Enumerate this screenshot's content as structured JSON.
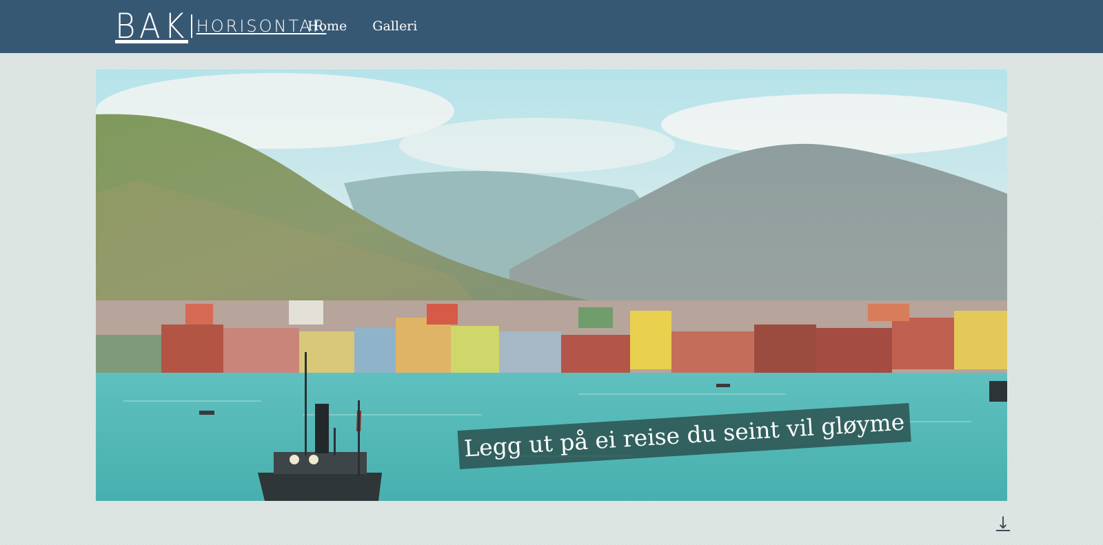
{
  "header": {
    "logo_main": "BAK",
    "logo_sub": "HORISONTAR",
    "nav": [
      {
        "label": "Home",
        "icon": ""
      },
      {
        "label": "Galleri",
        "icon": ""
      }
    ],
    "background_color": "#375873"
  },
  "hero": {
    "image_alt": "Hand-coloured historic photograph of a harbour town with mountains and a steamboat",
    "caption": "Legg ut på ei reise du seint vil gløyme"
  },
  "scroll": {
    "icon": "arrow-down-icon",
    "glyph": "↓"
  }
}
